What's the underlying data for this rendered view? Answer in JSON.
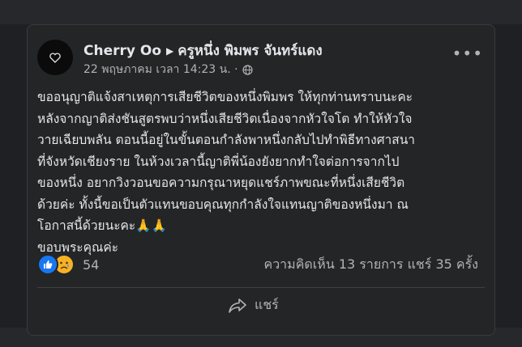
{
  "post": {
    "author": "Cherry Oo",
    "recipient": "ครูหนึ่ง พิมพร จันทร์แดง",
    "timestamp": "22 พฤษภาคม เวลา 14:23 น. ·",
    "audience_icon": "globe-icon",
    "more_label": "•••",
    "text_lines": [
      "ขออนุญาติแจ้งสาเหตุการเสียชีวิตของหนึ่งพิมพร ให้ทุกท่านทราบนะคะ",
      "หลังจากญาติส่งชันสูตรพบว่าหนึ่งเสียชีวิตเนื่องจากหัวใจโต ทำให้หัวใจ",
      "วายเฉียบพลัน ตอนนี้อยู่ในขั้นตอนกำลังพาหนึ่งกลับไปทำพิธีทางศาสนา",
      "ที่จังหวัดเชียงราย ในห้วงเวลานี้ญาติพี่น้องยังยากทำใจต่อการจากไป",
      "ของหนึ่ง อยากวิงวอนขอความกรุณาหยุดแชร์ภาพขณะที่หนึ่งเสียชีวิต",
      "ด้วยค่ะ ทั้งนี้ขอเป็นตัวแทนขอบคุณทุกกำลังใจแทนญาติของหนึ่งมา ณ",
      "โอกาสนี้ด้วยนะคะ🙏🙏",
      "ขอบพระคุณค่ะ"
    ]
  },
  "reactions": {
    "types": [
      "like",
      "sad"
    ],
    "count": "54"
  },
  "stats": {
    "text": "ความคิดเห็น 13 รายการ  แชร์ 35 ครั้ง"
  },
  "actions": {
    "share_label": "แชร์"
  },
  "colors": {
    "card_bg": "#242526",
    "like_blue": "#1877f2",
    "sad_yellow": "#f7b125"
  }
}
